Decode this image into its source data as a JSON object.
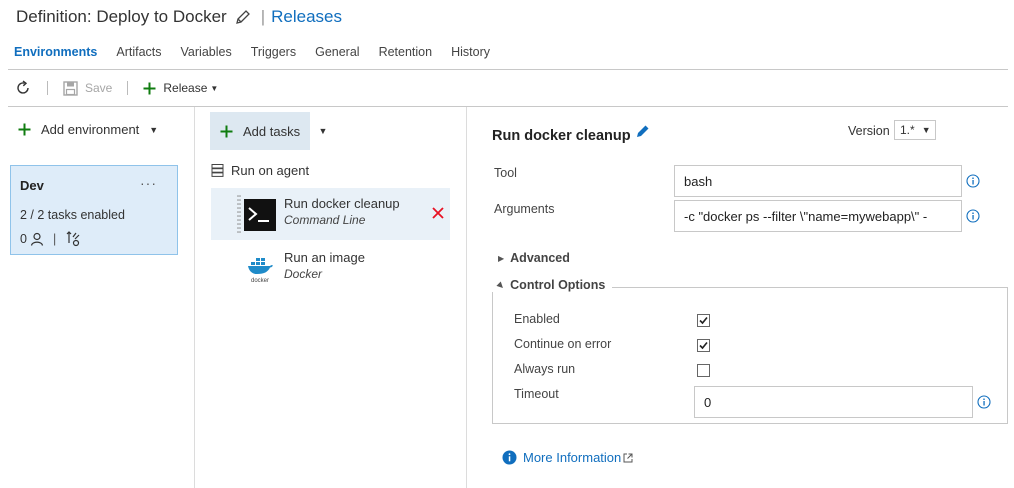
{
  "header": {
    "title": "Definition: Deploy to Docker",
    "separator": "|",
    "releases_link": "Releases"
  },
  "tabs": [
    {
      "label": "Environments",
      "active": true
    },
    {
      "label": "Artifacts"
    },
    {
      "label": "Variables"
    },
    {
      "label": "Triggers"
    },
    {
      "label": "General"
    },
    {
      "label": "Retention"
    },
    {
      "label": "History"
    }
  ],
  "toolbar": {
    "save_label": "Save",
    "release_label": "Release"
  },
  "environments": {
    "add_label": "Add environment",
    "card": {
      "name": "Dev",
      "more": "···",
      "tasks_enabled": "2 / 2 tasks enabled",
      "approvers_count": "0",
      "bar": "|"
    }
  },
  "tasks_panel": {
    "add_tasks_label": "Add tasks",
    "agent_label": "Run on agent",
    "tasks": [
      {
        "name": "Run docker cleanup",
        "type": "Command Line",
        "selected": true
      },
      {
        "name": "Run an image",
        "type": "Docker",
        "selected": false
      }
    ]
  },
  "detail": {
    "title": "Run docker cleanup",
    "version_label": "Version",
    "version_value": "1.*",
    "tool_label": "Tool",
    "tool_value": "bash",
    "arguments_label": "Arguments",
    "arguments_value": "-c \"docker ps --filter \\\"name=mywebapp\\\" -",
    "advanced_label": "Advanced",
    "control_options_label": "Control Options",
    "enabled_label": "Enabled",
    "enabled_checked": true,
    "continue_on_error_label": "Continue on error",
    "continue_on_error_checked": true,
    "always_run_label": "Always run",
    "always_run_checked": false,
    "timeout_label": "Timeout",
    "timeout_value": "0",
    "more_info_label": "More Information"
  },
  "colors": {
    "accent": "#106ebe",
    "add_green": "#107c10",
    "delete_red": "#e81123",
    "env_card_bg": "#deecf9",
    "selected_task_bg": "#e9f1f8"
  }
}
